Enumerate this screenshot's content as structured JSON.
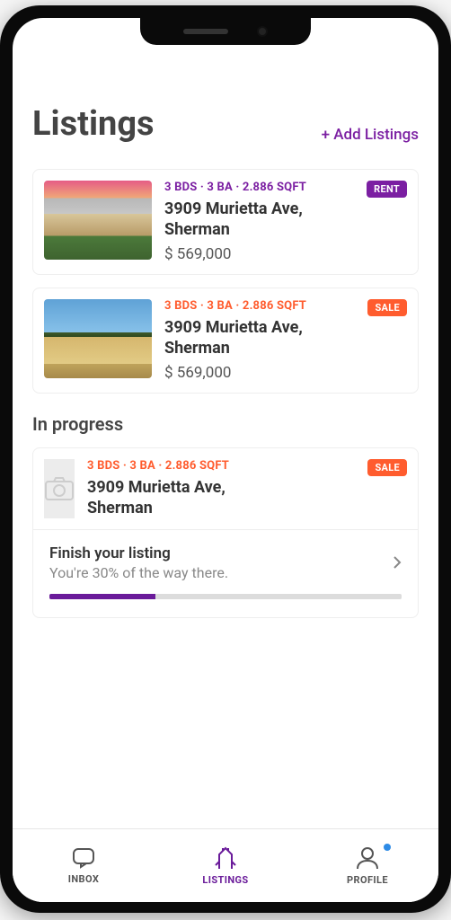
{
  "header": {
    "title": "Listings",
    "add_label": "+ Add Listings"
  },
  "listings": [
    {
      "specs": "3 BDS · 3 BA · 2.886 SQFT",
      "address": "3909 Murietta Ave, Sherman",
      "price": "$ 569,000",
      "badge": "RENT",
      "badge_class": "rent",
      "spec_class": "purple",
      "thumb_class": "house1"
    },
    {
      "specs": "3 BDS · 3 BA · 2.886 SQFT",
      "address": "3909 Murietta Ave, Sherman",
      "price": "$ 569,000",
      "badge": "SALE",
      "badge_class": "sale",
      "spec_class": "orange",
      "thumb_class": "house2"
    }
  ],
  "in_progress": {
    "section_title": "In progress",
    "specs": "3 BDS · 3 BA · 2.886 SQFT",
    "address": "3909 Murietta Ave, Sherman",
    "badge": "SALE",
    "badge_class": "sale",
    "spec_class": "orange",
    "finish_title": "Finish your listing",
    "finish_sub": "You're 30% of the way there.",
    "progress_pct": 30
  },
  "tabs": {
    "inbox": "INBOX",
    "listings": "LISTINGS",
    "profile": "PROFILE"
  }
}
